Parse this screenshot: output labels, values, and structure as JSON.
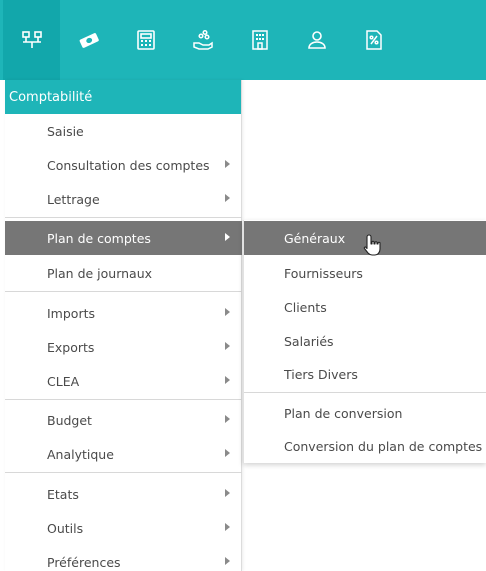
{
  "toolbar": {
    "icons": [
      "network-icon",
      "money-icon",
      "calculator-icon",
      "hand-coins-icon",
      "building-icon",
      "user-icon",
      "percent-document-icon"
    ]
  },
  "menu": {
    "title": "Comptabilité",
    "items": [
      {
        "label": "Saisie",
        "has_submenu": false
      },
      {
        "label": "Consultation des comptes",
        "has_submenu": true
      },
      {
        "label": "Lettrage",
        "has_submenu": true
      },
      {
        "label": "Plan de comptes",
        "has_submenu": true,
        "selected": true
      },
      {
        "label": "Plan de journaux",
        "has_submenu": false
      },
      {
        "label": "Imports",
        "has_submenu": true
      },
      {
        "label": "Exports",
        "has_submenu": true
      },
      {
        "label": "CLEA",
        "has_submenu": true
      },
      {
        "label": "Budget",
        "has_submenu": true
      },
      {
        "label": "Analytique",
        "has_submenu": true
      },
      {
        "label": "Etats",
        "has_submenu": true
      },
      {
        "label": "Outils",
        "has_submenu": true
      },
      {
        "label": "Préférences",
        "has_submenu": true
      }
    ]
  },
  "submenu": {
    "items": [
      {
        "label": "Généraux",
        "selected": true
      },
      {
        "label": "Fournisseurs"
      },
      {
        "label": "Clients"
      },
      {
        "label": "Salariés"
      },
      {
        "label": "Tiers Divers"
      },
      {
        "label": "Plan de conversion"
      },
      {
        "label": "Conversion du plan de comptes"
      }
    ]
  },
  "colors": {
    "accent": "#1eb5b8",
    "selected": "#767676"
  }
}
